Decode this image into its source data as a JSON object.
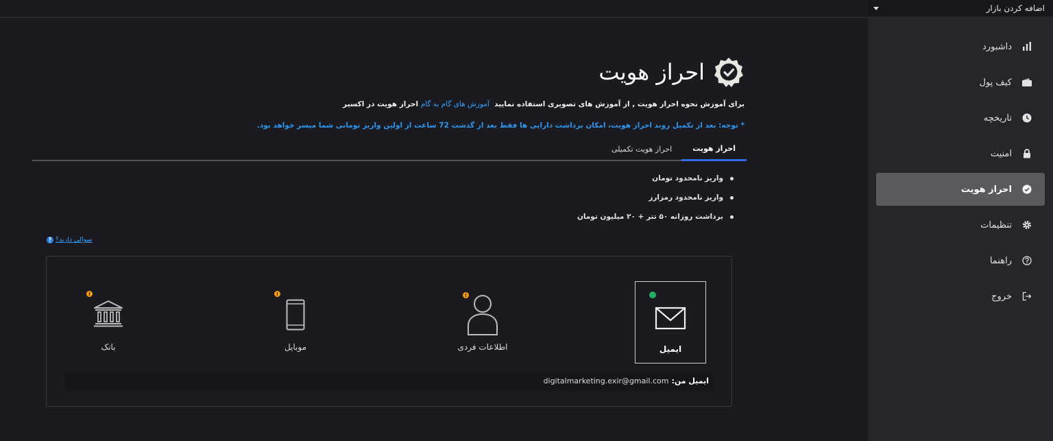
{
  "sidebar": {
    "market_select": "اضافه کردن بازار",
    "items": [
      {
        "label": "داشبورد",
        "icon": "bar-chart-icon",
        "active": false
      },
      {
        "label": "کیف پول",
        "icon": "wallet-icon",
        "active": false
      },
      {
        "label": "تاریخچه",
        "icon": "clock-icon",
        "active": false
      },
      {
        "label": "امنیت",
        "icon": "lock-icon",
        "active": false
      },
      {
        "label": "احراز هویت",
        "icon": "check-badge-icon",
        "active": true
      },
      {
        "label": "تنظیمات",
        "icon": "gear-icon",
        "active": false
      },
      {
        "label": "راهنما",
        "icon": "question-circle-icon",
        "active": false
      },
      {
        "label": "خروج",
        "icon": "logout-icon",
        "active": false
      }
    ]
  },
  "main": {
    "title": "احراز هویت",
    "intro_prefix": "برای آموزش نحوه احراز هویت , از آموزش های تصویری استفاده نمایید",
    "intro_link": "آموزش های گام به گام",
    "intro_suffix": "احراز هویت در اکسیر",
    "notice": "* توجه: بعد از تکمیل روند احراز هویت، امکان برداشت دارایی ها فقط بعد از گذشت 72 ساعت از اولین واریز تومانی شما میسر خواهد بود.",
    "tabs": [
      {
        "label": "احراز هویت",
        "active": true
      },
      {
        "label": "احراز هویت تکمیلی",
        "active": false
      }
    ],
    "features": [
      "واریز نامحدود تومان",
      "واریز نامحدود رمزارز",
      "برداشت روزانه ۵۰ تتر + ۲۰ میلیون تومان"
    ],
    "help_link": "سوالی دارید؟",
    "steps": {
      "email": {
        "label": "ایمیل",
        "status": "done"
      },
      "personal": {
        "label": "اطلاعات فردی",
        "status": "pending"
      },
      "mobile": {
        "label": "موبایل",
        "status": "pending"
      },
      "bank": {
        "label": "بانک",
        "status": "pending"
      }
    },
    "email_row": {
      "key": "ایمیل من:",
      "value": "digitalmarketing.exir@gmail.com"
    }
  },
  "colors": {
    "background": "#1b1a20",
    "sidebar": "#26252b",
    "active_nav": "#5a595f",
    "link_blue": "#35a3ff",
    "tab_underline": "#2e6fe6",
    "warning": "#f39c12",
    "success": "#27ae60"
  }
}
